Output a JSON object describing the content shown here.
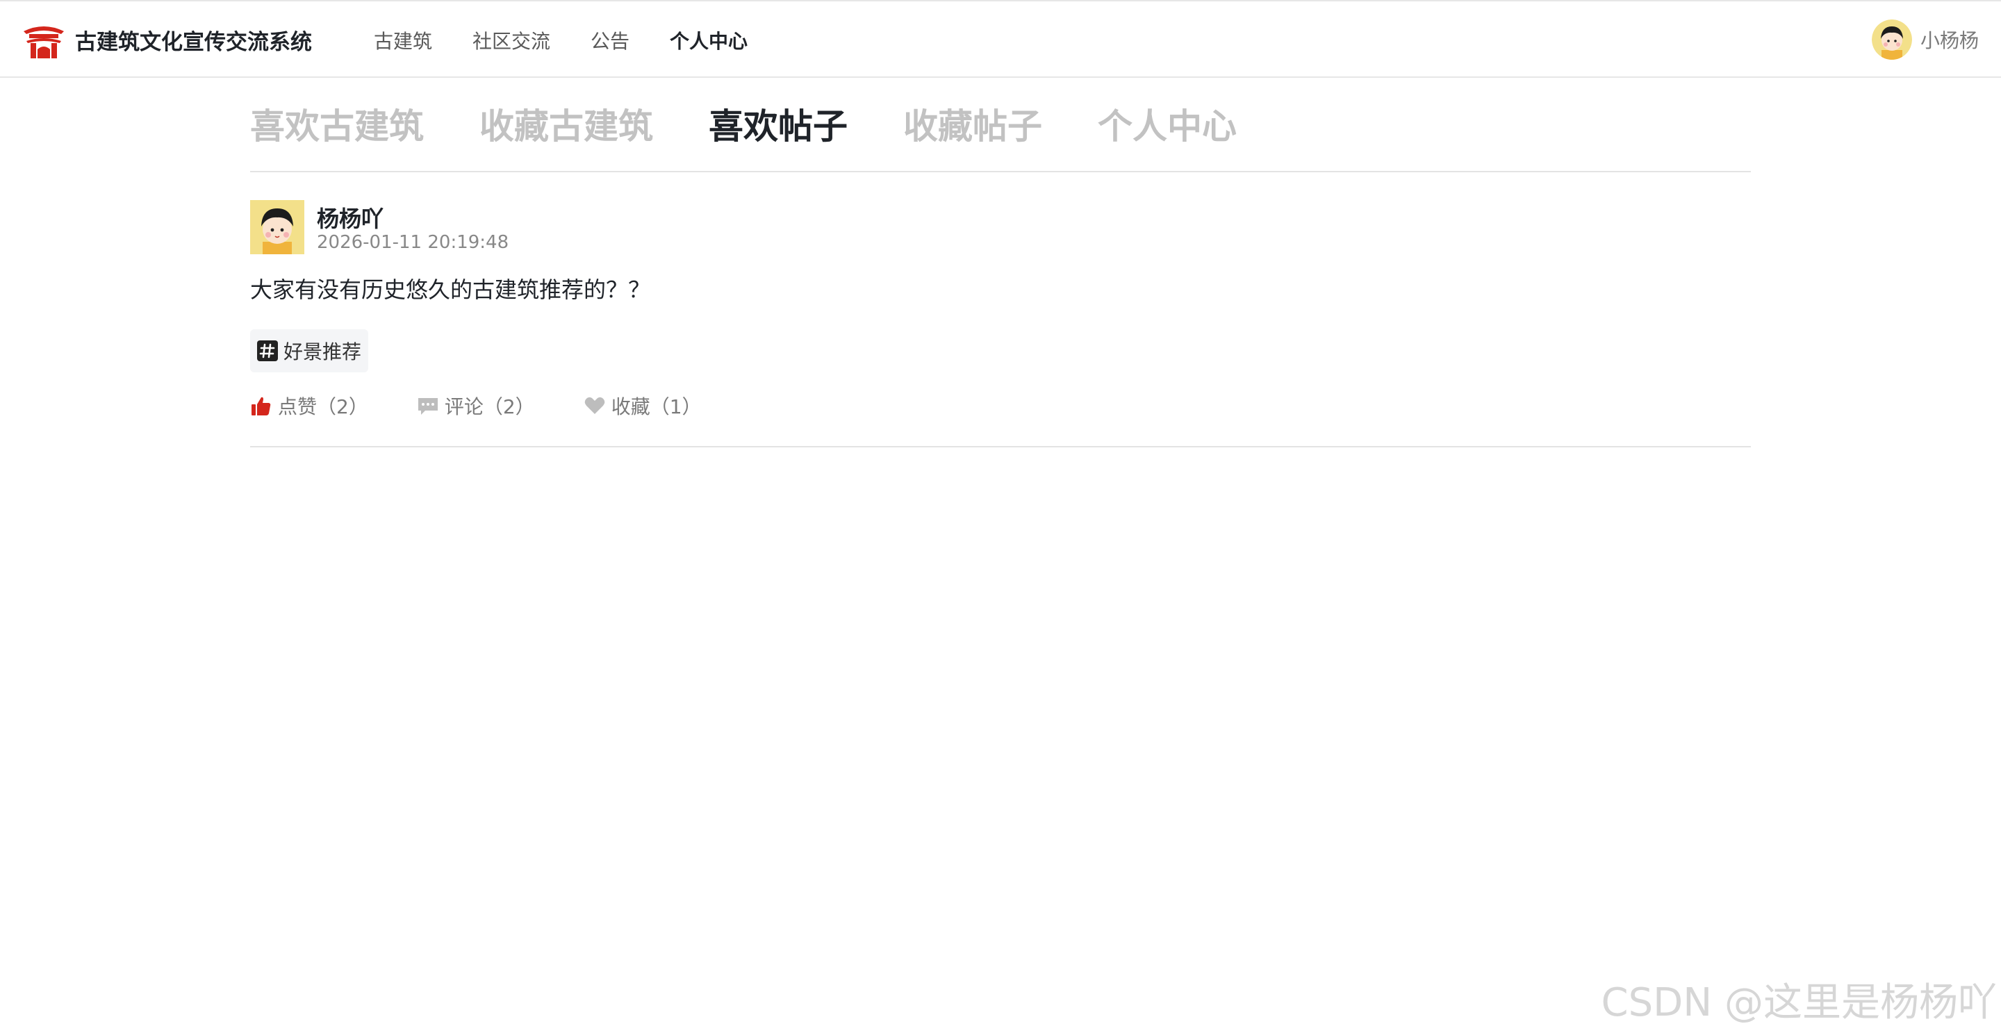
{
  "brand": {
    "title": "古建筑文化宣传交流系统",
    "icon": "temple-gate-icon",
    "accent_color": "#d4261c"
  },
  "nav": {
    "items": [
      {
        "label": "古建筑",
        "active": false
      },
      {
        "label": "社区交流",
        "active": false
      },
      {
        "label": "公告",
        "active": false
      },
      {
        "label": "个人中心",
        "active": true
      }
    ]
  },
  "user": {
    "name": "小杨杨",
    "avatar": "avatar-icon"
  },
  "tabs": [
    {
      "label": "喜欢古建筑",
      "active": false
    },
    {
      "label": "收藏古建筑",
      "active": false
    },
    {
      "label": "喜欢帖子",
      "active": true
    },
    {
      "label": "收藏帖子",
      "active": false
    },
    {
      "label": "个人中心",
      "active": false
    }
  ],
  "post": {
    "author": "杨杨吖",
    "time": "2026-01-11 20:19:48",
    "content": "大家有没有历史悠久的古建筑推荐的？？",
    "tag": {
      "label": "好景推荐",
      "icon": "hash-icon"
    },
    "actions": {
      "like": {
        "label": "点赞",
        "count": "（2）",
        "icon": "thumbs-up-icon",
        "active": true,
        "color": "#d4261c"
      },
      "comment": {
        "label": "评论",
        "count": "（2）",
        "icon": "comment-icon"
      },
      "favorite": {
        "label": "收藏",
        "count": "（1）",
        "icon": "heart-icon"
      }
    }
  },
  "watermark": "CSDN @这里是杨杨吖"
}
